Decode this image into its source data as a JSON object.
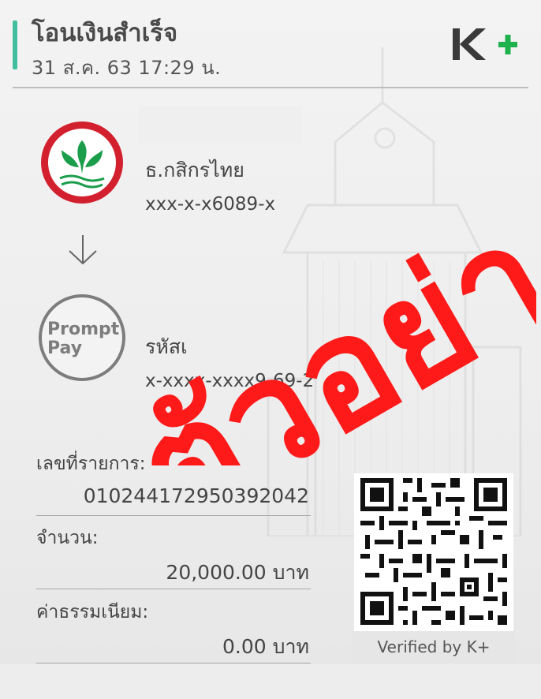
{
  "header": {
    "title": "โอนเงินสำเร็จ",
    "datetime": "31 ส.ค. 63  17:29 น.",
    "logo_text": "K+"
  },
  "sender": {
    "bank": "ธ.กสิกรไทย",
    "account": "xxx-x-x6089-x",
    "icon": "kasikorn-bank-logo-icon"
  },
  "receiver": {
    "label": "รหัสเ",
    "account": "x-xxxx-xxxx9-69-2",
    "icon_text_1": "Prompt",
    "icon_text_2": "Pay"
  },
  "details": {
    "ref_label": "เลขที่รายการ:",
    "ref_value": "010244172950392042",
    "amount_label": "จำนวน:",
    "amount_value": "20,000.00 บาท",
    "fee_label": "ค่าธรรมเนียม:",
    "fee_value": "0.00 บาท"
  },
  "qr": {
    "verified": "Verified by K+"
  },
  "watermark": {
    "text": "ตัวอย่าง"
  },
  "colors": {
    "accent": "#3fbf9f",
    "kasikorn_green": "#1a9e4b",
    "kasikorn_red": "#d3202f",
    "watermark": "#ff1a1a",
    "logo_dark": "#3a3a3a",
    "logo_plus": "#1fb14d"
  }
}
